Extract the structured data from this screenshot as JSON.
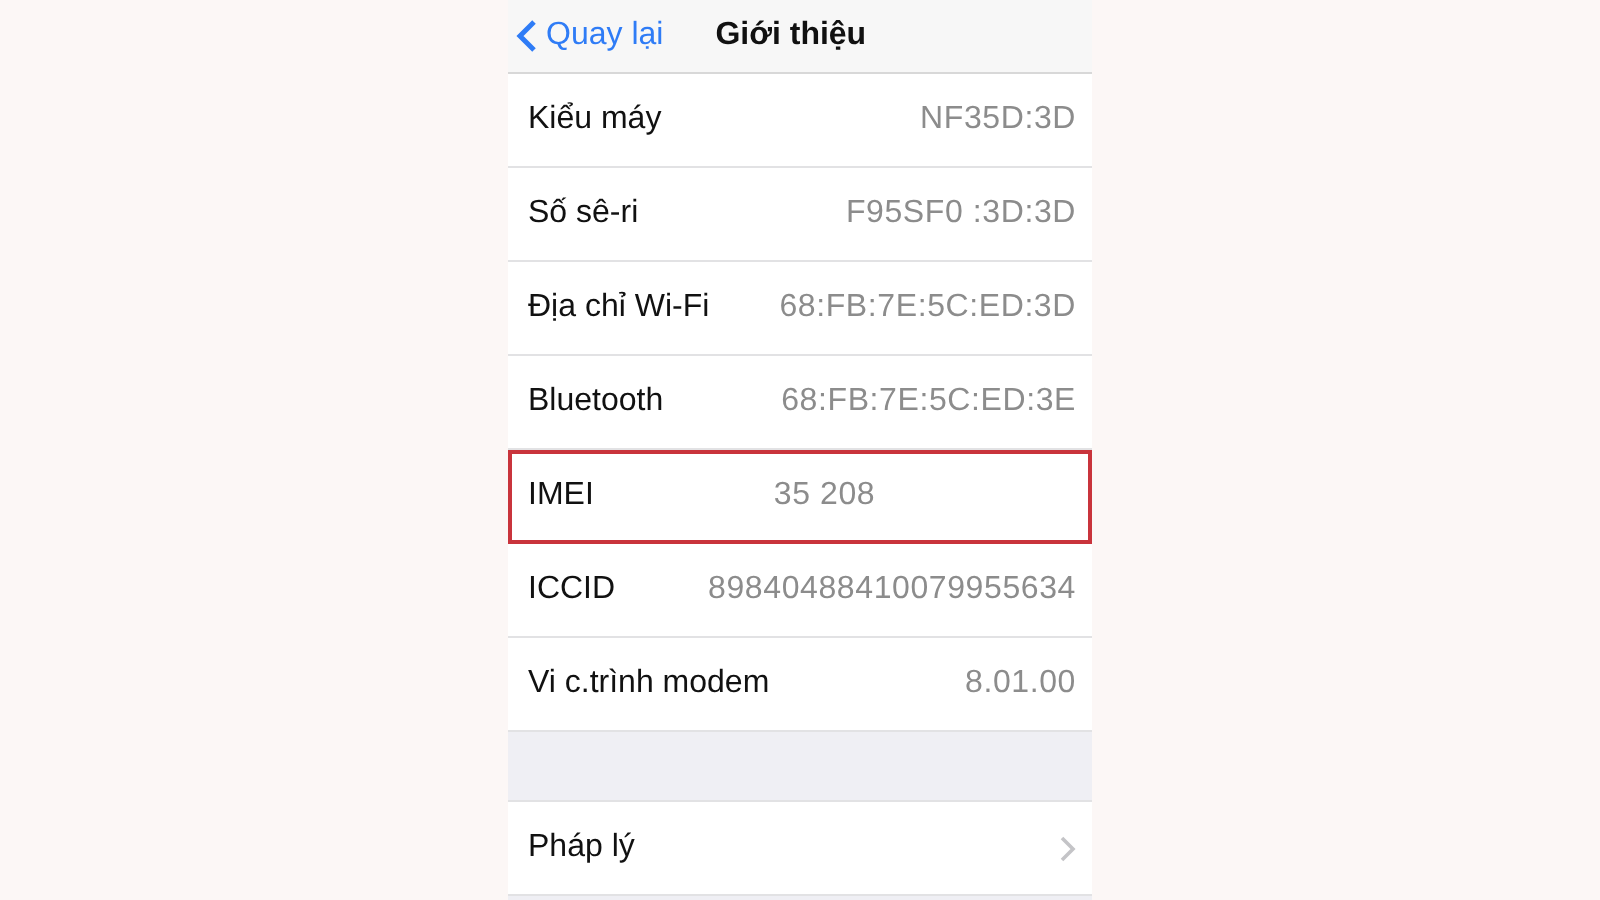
{
  "nav_bar": {
    "back_label": "Quay lại",
    "title": "Giới thiệu"
  },
  "sections": [
    {
      "rows": [
        {
          "kind": "value",
          "label": "Kiểu máy",
          "value": "NF35D:3D",
          "highlighted": false
        },
        {
          "kind": "value",
          "label": "Số sê-ri",
          "value": "F95SF0 :3D:3D",
          "highlighted": false
        },
        {
          "kind": "value",
          "label": "Địa chỉ Wi-Fi",
          "value": "68:FB:7E:5C:ED:3D",
          "highlighted": false
        },
        {
          "kind": "value",
          "label": "Bluetooth",
          "value": "68:FB:7E:5C:ED:3E",
          "highlighted": false
        },
        {
          "kind": "value",
          "label": "IMEI",
          "value": "35 208",
          "highlighted": true
        },
        {
          "kind": "value",
          "label": "ICCID",
          "value": "89840488410079955634",
          "highlighted": false
        },
        {
          "kind": "value",
          "label": "Vi c.trình modem",
          "value": "8.01.00",
          "highlighted": false
        }
      ]
    },
    {
      "rows": [
        {
          "kind": "link",
          "label": "Pháp lý",
          "highlighted": false
        }
      ]
    }
  ]
}
